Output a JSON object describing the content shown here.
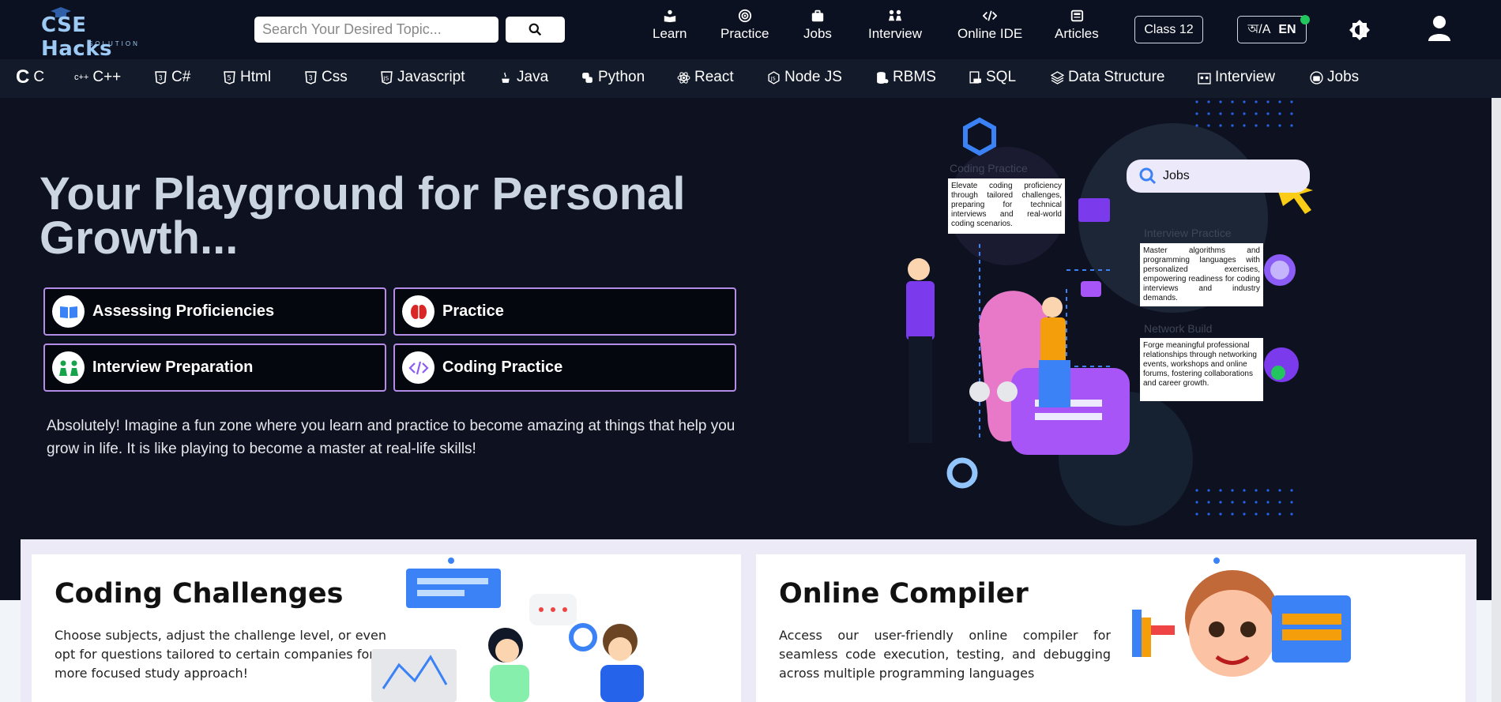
{
  "header": {
    "logo_text": "CSE Hacks",
    "logo_sub": "SOLUTION",
    "search": {
      "placeholder": "Search Your Desired Topic..."
    },
    "nav": [
      {
        "label": "Learn",
        "icon": "book-icon"
      },
      {
        "label": "Practice",
        "icon": "target-icon"
      },
      {
        "label": "Jobs",
        "icon": "briefcase-icon"
      },
      {
        "label": "Interview",
        "icon": "people-icon"
      },
      {
        "label": "Online IDE",
        "icon": "code-icon"
      },
      {
        "label": "Articles",
        "icon": "newspaper-icon"
      }
    ],
    "class_label": "Class 12",
    "lang_script": "অ/A",
    "lang_code": "EN"
  },
  "techbar": {
    "items": [
      "C",
      "C++",
      "C#",
      "Html",
      "Css",
      "Javascript",
      "Java",
      "Python",
      "React",
      "Node JS",
      "RBMS",
      "SQL",
      "Data Structure",
      "Interview",
      "Jobs"
    ]
  },
  "hero": {
    "title": "Your Playground for Personal Growth...",
    "features": [
      {
        "label": "Assessing Proficiencies",
        "icon": "open-book-icon"
      },
      {
        "label": "Practice",
        "icon": "brain-icon"
      },
      {
        "label": "Interview Preparation",
        "icon": "interview-icon"
      },
      {
        "label": "Coding Practice",
        "icon": "code-icon"
      }
    ],
    "description": "Absolutely! Imagine a fun zone where you learn and practice to become amazing at things that help you grow in life. It is like playing to become a master at real-life skills!"
  },
  "illustration": {
    "search_text": "Jobs",
    "coding_head": "Coding Practice",
    "coding_text": "Elevate coding proficiency through tailored challenges, preparing for technical interviews and real-world coding scenarios.",
    "interview_head": "Interview Practice",
    "interview_text": "Master algorithms and programming languages with personalized exercises, empowering readiness for coding interviews and industry demands.",
    "network_head": "Network Build",
    "network_text": "Forge meaningful professional relationships through networking events, workshops and online forums, fostering collaborations and career growth."
  },
  "cards": [
    {
      "title": "Coding Challenges",
      "description": "Choose subjects, adjust the challenge level, or even opt for questions tailored to certain companies for a more focused study approach!"
    },
    {
      "title": "Online Compiler",
      "description": "Access our user-friendly online compiler for seamless code execution, testing, and debugging across multiple programming languages"
    }
  ],
  "colors": {
    "accent_border": "#b48ce8",
    "header_bg": "#0b1120",
    "page_bg": "#0e1220"
  }
}
